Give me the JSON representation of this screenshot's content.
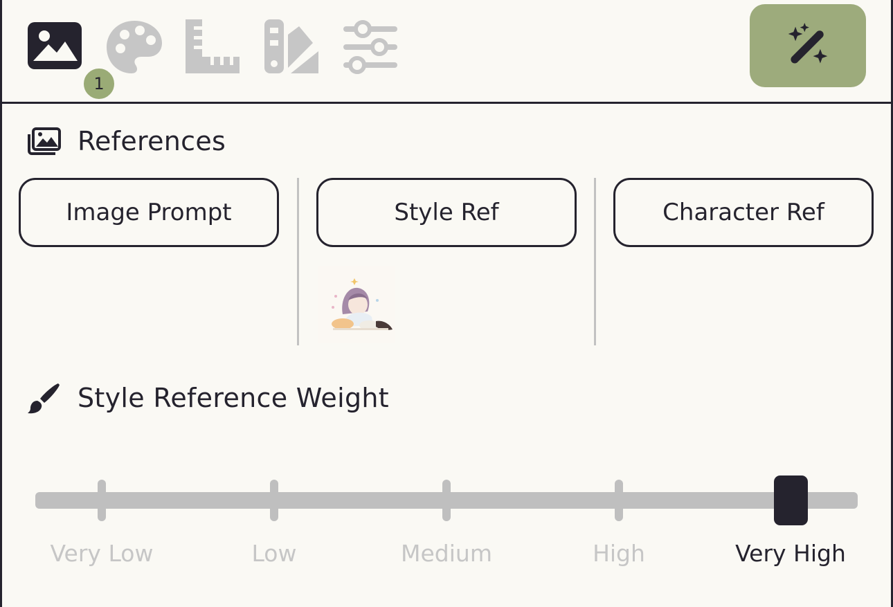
{
  "toolbar": {
    "tabs": [
      {
        "icon": "image-icon",
        "active": true,
        "badge": "1"
      },
      {
        "icon": "palette-icon",
        "active": false
      },
      {
        "icon": "ruler-icon",
        "active": false
      },
      {
        "icon": "swatch-icon",
        "active": false
      },
      {
        "icon": "sliders-icon",
        "active": false
      }
    ],
    "action_icon": "magic-wand-icon",
    "accent_color": "#9dab7c"
  },
  "references": {
    "title": "References",
    "icon": "image-stack-icon",
    "buttons": [
      "Image Prompt",
      "Style Ref",
      "Character Ref"
    ]
  },
  "style_weight": {
    "title": "Style Reference Weight",
    "icon": "brush-icon",
    "levels": [
      "Very Low",
      "Low",
      "Medium",
      "High",
      "Very High"
    ],
    "selected": "Very High"
  }
}
